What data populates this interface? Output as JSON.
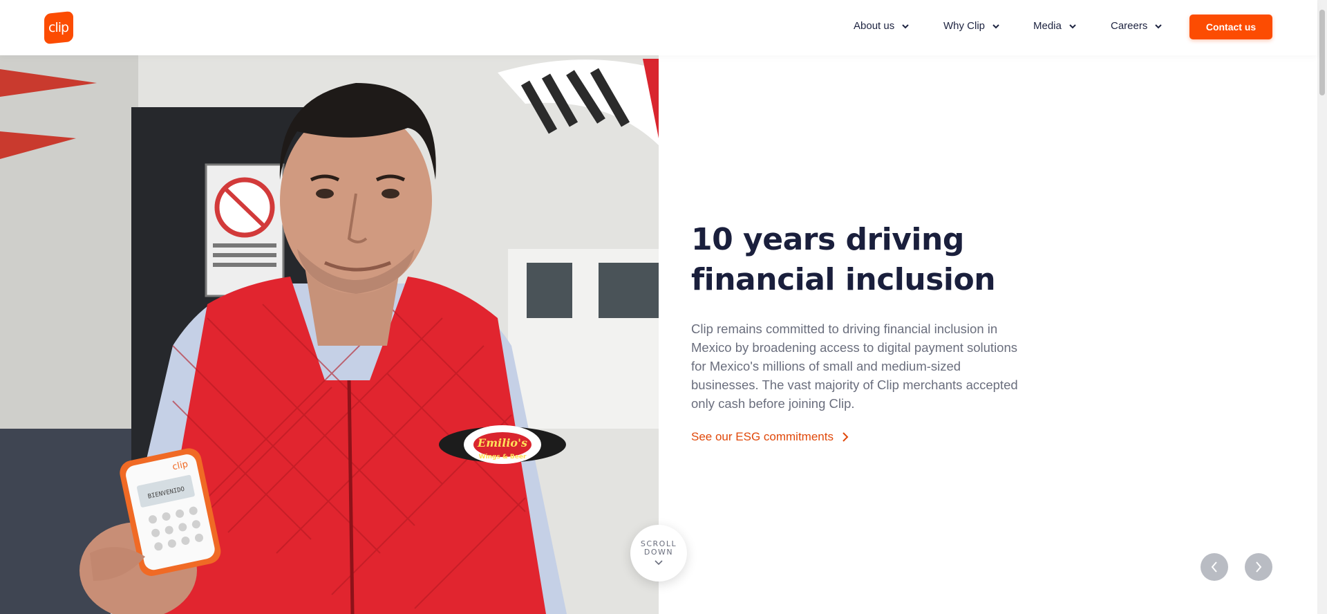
{
  "brand": {
    "logo_text": "clip",
    "accent_color": "#fc4c02"
  },
  "nav": {
    "items": [
      {
        "label": "About us"
      },
      {
        "label": "Why Clip"
      },
      {
        "label": "Media"
      },
      {
        "label": "Careers"
      }
    ],
    "contact_label": "Contact us"
  },
  "hero": {
    "headline_line1": "10 years driving",
    "headline_line2": "financial inclusion",
    "description": "Clip remains committed to driving financial inclusion in Mexico by broadening access to digital payment solutions for Mexico's millions of small and medium-sized businesses. The vast majority of Clip merchants accepted only cash before joining Clip.",
    "link_label": "See our ESG commitments",
    "image": {
      "vest_patch": "Emilio's",
      "vest_patch_sub": "Wings & Beer",
      "device_brand": "clip",
      "device_screen": "BIENVENIDO"
    }
  },
  "scroll_hint": {
    "line1": "SCROLL",
    "line2": "DOWN"
  },
  "carousel": {
    "prev_icon": "chevron-left-icon",
    "next_icon": "chevron-right-icon"
  }
}
